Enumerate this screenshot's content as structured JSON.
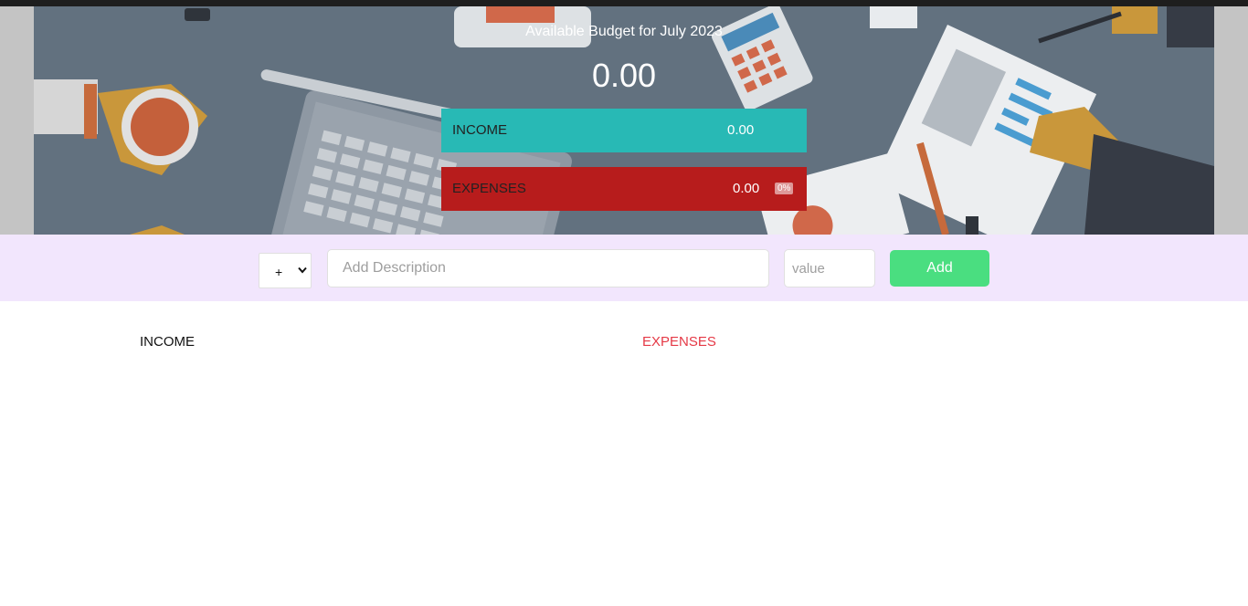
{
  "header": {
    "title": "Available Budget for July 2023",
    "budget_value": "0.00"
  },
  "summary": {
    "income": {
      "label": "INCOME",
      "value": "0.00",
      "color": "#28b9b5"
    },
    "expenses": {
      "label": "EXPENSES",
      "value": "0.00",
      "percentage": "0%",
      "color": "#b71c1c"
    }
  },
  "add_form": {
    "type_selected": "+",
    "description_placeholder": "Add Description",
    "value_placeholder": "value",
    "add_label": "Add",
    "button_color": "#4ade80",
    "background": "#f2e6fd"
  },
  "lists": {
    "income_title": "INCOME",
    "expenses_title": "EXPENSES",
    "expenses_color": "#e53946"
  }
}
